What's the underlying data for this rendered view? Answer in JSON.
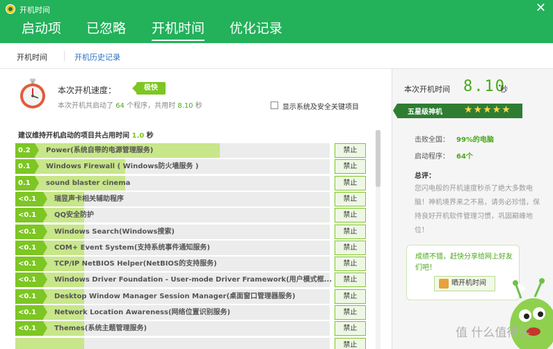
{
  "window": {
    "title": "开机时间"
  },
  "tabs": [
    {
      "label": "启动项"
    },
    {
      "label": "已忽略"
    },
    {
      "label": "开机时间"
    },
    {
      "label": "优化记录"
    }
  ],
  "subnav": {
    "item1": "开机时间",
    "item2": "开机历史记录"
  },
  "speed": {
    "title": "本次开机速度：",
    "badge": "极快",
    "desc_prefix": "本次开机共启动了 ",
    "program_count": "64",
    "desc_mid": " 个程序，共用时 ",
    "seconds": "8.10",
    "desc_suffix": " 秒",
    "show_system_label": "显示系统及安全关键项目"
  },
  "summary": {
    "prefix": "建议维持开机启动的项目共占用时间 ",
    "value": "1.0",
    "suffix": " 秒"
  },
  "ban_label": "禁止",
  "items": [
    {
      "time": "0.2秒",
      "name": "Power(系统自带的电源管理服务)",
      "fill": 0.65
    },
    {
      "time": "0.1秒",
      "name": "Windows Firewall ( Windows防火墙服务 )",
      "fill": 0.35
    },
    {
      "time": "0.1秒",
      "name": "sound blaster cinema",
      "fill": 0.35
    },
    {
      "time": "<0.1秒",
      "name": "瑞昱声卡相关辅助程序",
      "fill": 0.22
    },
    {
      "time": "<0.1秒",
      "name": "QQ安全防护",
      "fill": 0.22
    },
    {
      "time": "<0.1秒",
      "name": "Windows Search(Windows搜索)",
      "fill": 0.22
    },
    {
      "time": "<0.1秒",
      "name": "COM+ Event System(支持系统事件通知服务)",
      "fill": 0.22
    },
    {
      "time": "<0.1秒",
      "name": "TCP/IP NetBIOS Helper(NetBIOS的支持服务)",
      "fill": 0.22
    },
    {
      "time": "<0.1秒",
      "name": "Windows Driver Foundation - User-mode Driver Framework(用户模式框...",
      "fill": 0.22
    },
    {
      "time": "<0.1秒",
      "name": "Desktop Window Manager Session Manager(桌面窗口管理器服务)",
      "fill": 0.22
    },
    {
      "time": "<0.1秒",
      "name": "Network Location Awareness(网络位置识别服务)",
      "fill": 0.22
    },
    {
      "time": "<0.1秒",
      "name": "Themes(系统主题管理服务)",
      "fill": 0.22
    },
    {
      "time": "",
      "name": "",
      "fill": 0.22
    }
  ],
  "right": {
    "title": "本次开机时间",
    "digits": "8.10",
    "unit": "秒",
    "rank_label": "五星级神机",
    "stars": "★★★★★",
    "star_count": 5,
    "beat_label": "击败全国：",
    "beat_value": "99%的电脑",
    "programs_label": "启动程序：",
    "programs_value": "64个",
    "comment_title": "总评：",
    "comment": "您闪电般的开机速度秒杀了绝大多数电脑！神机境界来之不易，请务必珍惜，保持良好开机软件管理习惯，巩固巅峰地位！",
    "bubble_text": "成绩不错，赶快分享给网上好友们吧！",
    "share_label": "晒开机时间",
    "watermark": "值 什么值得买"
  },
  "colors": {
    "header": "#23b15a",
    "accent": "#7dc623",
    "bar_fill": "#c8e68a",
    "digits": "#4aa81a"
  }
}
